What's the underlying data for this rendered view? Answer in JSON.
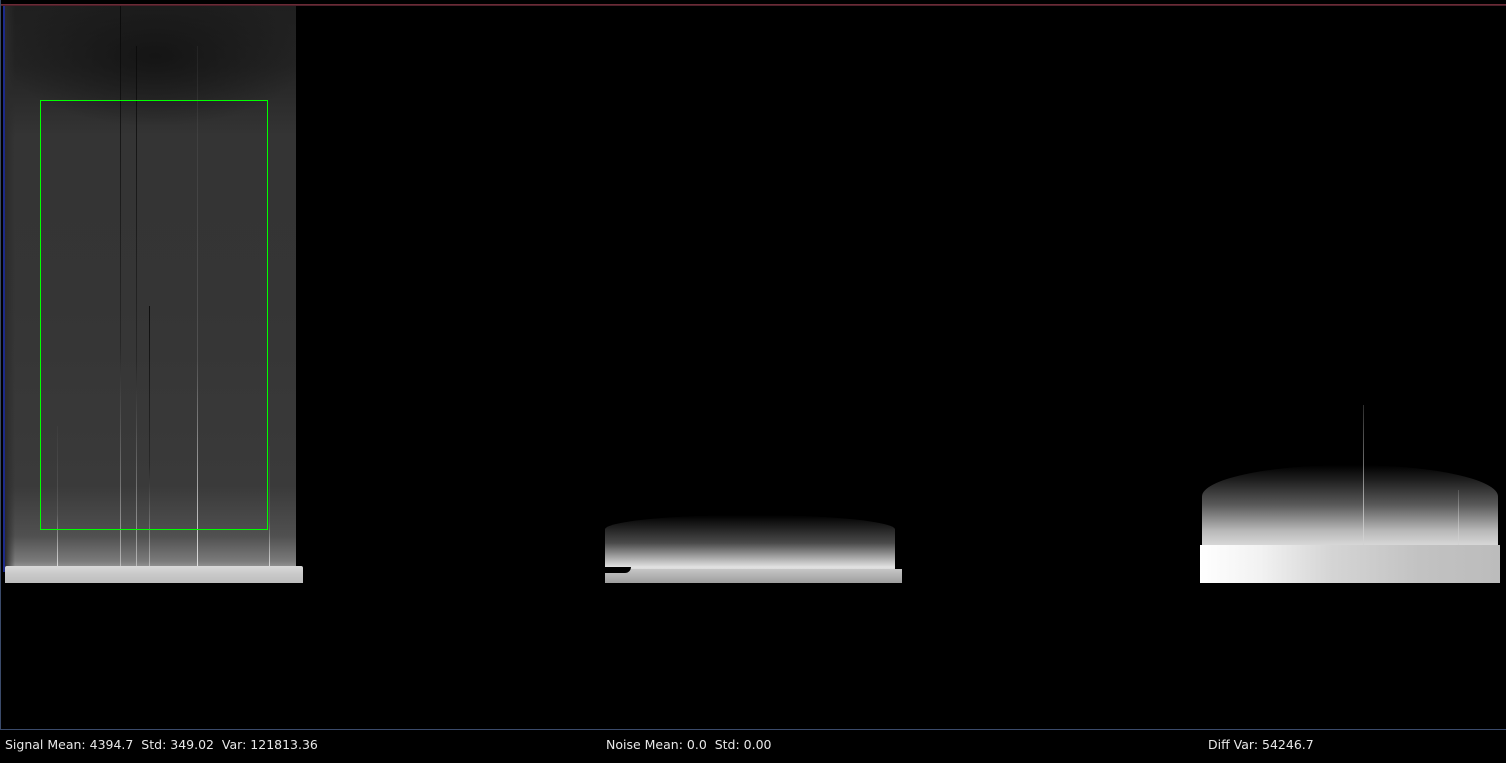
{
  "status_bar": {
    "signal": "Signal Mean: 4394.7  Std: 349.02  Var: 121813.36",
    "noise": "Noise Mean: 0.0  Std: 0.00",
    "diff": "Diff Var: 54246.7"
  },
  "colors": {
    "roi_outline": "#00ff00",
    "top_line": "#7a2f3a",
    "left_edge": "#1d2a8a",
    "background": "#000000",
    "text": "#e8e8e8"
  }
}
